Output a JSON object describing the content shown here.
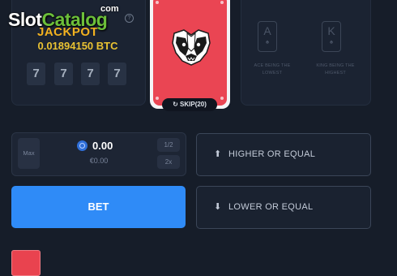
{
  "watermark": {
    "brand_a": "Slot",
    "brand_b": "Catalog",
    "suffix": "com"
  },
  "jackpot": {
    "label": "JACKPOT",
    "help_icon": "question-circle-icon",
    "amount": "0.01894150 BTC",
    "digits": [
      "7",
      "7",
      "7",
      "7"
    ]
  },
  "card": {
    "back_logo": "badger-head-icon",
    "skip_label": "SKIP(20)",
    "skip_icon": "refresh-icon"
  },
  "rules": {
    "ace": {
      "rank": "A",
      "text": "ACE BEING THE LOWEST"
    },
    "king": {
      "rank": "K",
      "text": "KING BEING THE HIGHEST"
    }
  },
  "bet_input": {
    "max_label": "Max",
    "currency_icon": "bitcoin-coin-icon",
    "value": "0.00",
    "fiat_value": "€0.00",
    "half_label": "1/2",
    "double_label": "2x"
  },
  "actions": {
    "bet_label": "BET",
    "higher_label": "HIGHER OR EQUAL",
    "higher_icon": "arrow-up-icon",
    "lower_label": "LOWER OR EQUAL",
    "lower_icon": "arrow-down-icon"
  },
  "colors": {
    "background": "#161d29",
    "card_red": "#ea4553",
    "bet_blue": "#2f8bf7",
    "jackpot_gold": "#f3b21f"
  }
}
